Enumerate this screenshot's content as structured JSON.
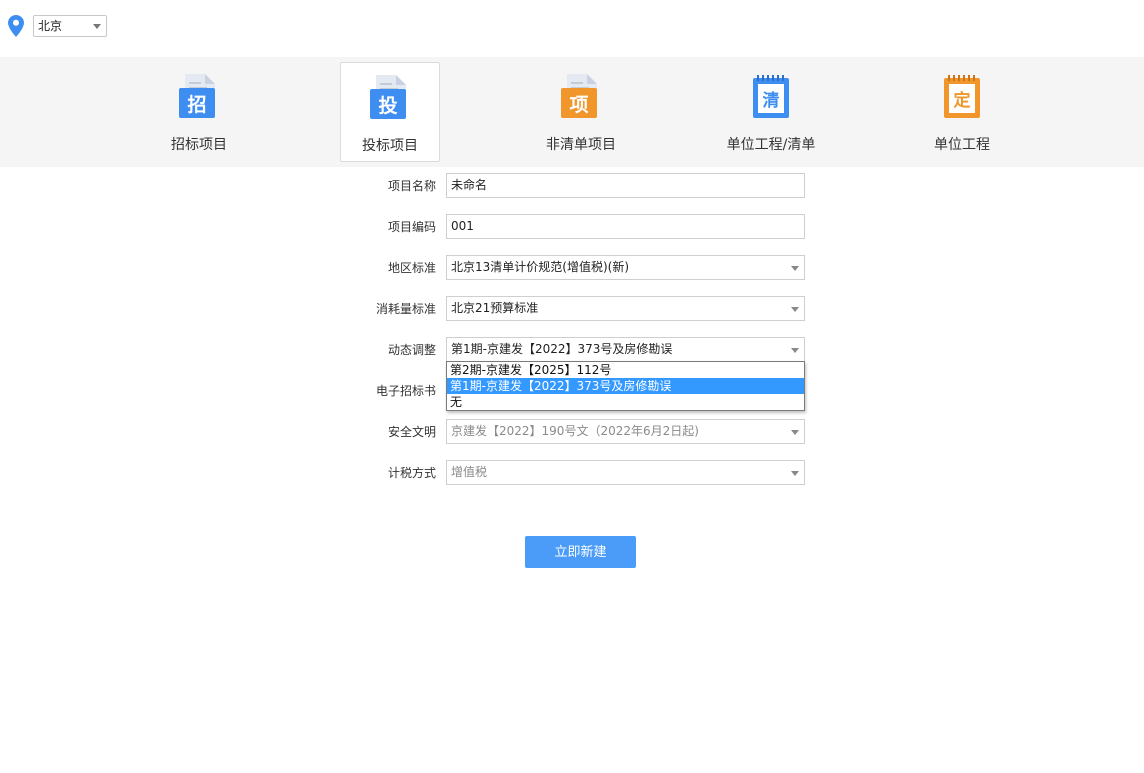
{
  "location": {
    "city": "北京",
    "icon": "location-pin-icon",
    "pin_color": "#3d8ef0"
  },
  "tabs": [
    {
      "label": "招标项目",
      "glyph": "招",
      "icon": "bid-doc-icon",
      "color": "#3d8ef0",
      "active": false
    },
    {
      "label": "投标项目",
      "glyph": "投",
      "icon": "tender-doc-icon",
      "color": "#3d8ef0",
      "active": true
    },
    {
      "label": "非清单项目",
      "glyph": "项",
      "icon": "project-doc-icon",
      "color": "#f0962a",
      "active": false
    },
    {
      "label": "单位工程/清单",
      "glyph": "清",
      "icon": "list-notebook-icon",
      "color": "#3d8ef0",
      "active": false
    },
    {
      "label": "单位工程",
      "glyph": "定",
      "icon": "quota-notebook-icon",
      "color": "#f0962a",
      "active": false
    }
  ],
  "form": {
    "project_name": {
      "label": "项目名称",
      "value": "未命名"
    },
    "project_code": {
      "label": "项目编码",
      "value": "001"
    },
    "region_standard": {
      "label": "地区标准",
      "value": "北京13清单计价规范(增值税)(新)"
    },
    "consumption_standard": {
      "label": "消耗量标准",
      "value": "北京21预算标准"
    },
    "dynamic_adjustment": {
      "label": "动态调整",
      "value": "第1期-京建发【2022】373号及房修勘误",
      "options": [
        "第2期-京建发【2025】112号",
        "第1期-京建发【2022】373号及房修勘误",
        "无"
      ],
      "highlighted_index": 1
    },
    "e_tender_doc": {
      "label": "电子招标书"
    },
    "safe_civilized": {
      "label": "安全文明",
      "value": "京建发【2022】190号文（2022年6月2日起)"
    },
    "tax_method": {
      "label": "计税方式",
      "value": "增值税"
    }
  },
  "submit_label": "立即新建",
  "colors": {
    "accent": "#4a9cf8",
    "selection": "#3399ff",
    "tab_bar_bg": "#f5f5f5"
  }
}
